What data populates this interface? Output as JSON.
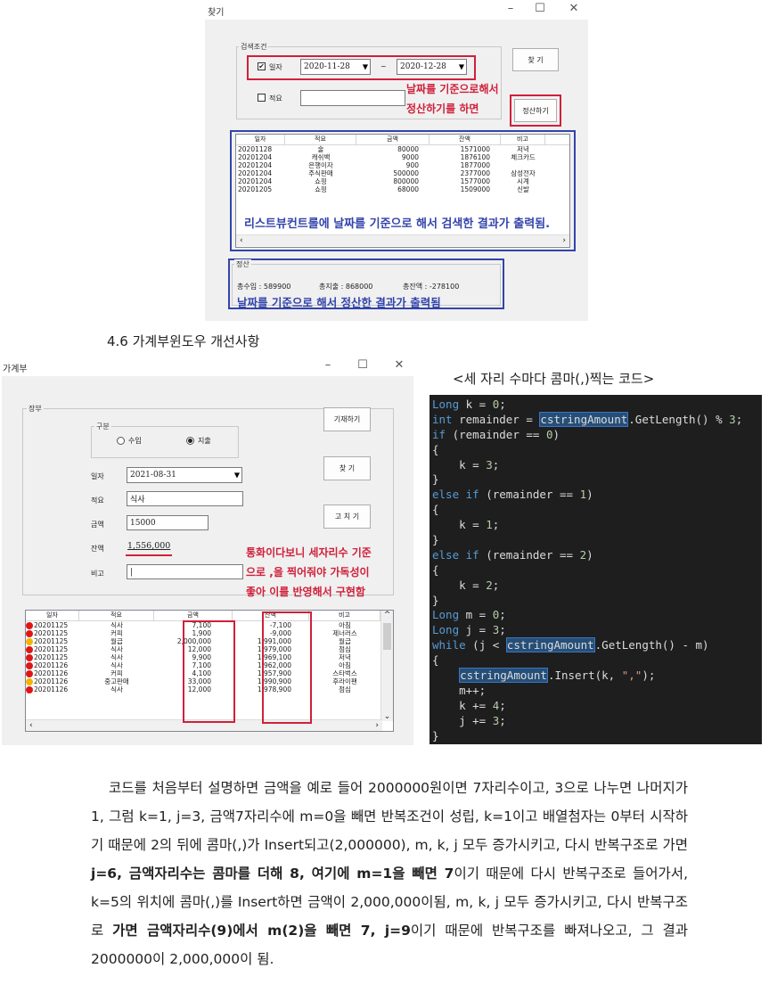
{
  "search_window": {
    "title": "찾기",
    "controls": [
      "–",
      "☐",
      "✕"
    ],
    "group_search": "검색조건",
    "date_check": "✔",
    "date_label": "일자",
    "date_from": "2020-11-28",
    "tilde": "~",
    "date_to": "2020-12-28",
    "memo_label": "적요",
    "find_button": "찾 기",
    "settle_button": "정산하기",
    "annotation_red": [
      "날짜를 기준으로해서",
      "정산하기를 하면"
    ],
    "list_headers": [
      "일자",
      "적요",
      "금액",
      "잔액",
      "비고"
    ],
    "list_rows": [
      [
        "20201128",
        "술",
        "80000",
        "1571000",
        "저녁"
      ],
      [
        "20201204",
        "캐쉬백",
        "9000",
        "1876100",
        "체크카드"
      ],
      [
        "20201204",
        "은행이자",
        "900",
        "1877000",
        ""
      ],
      [
        "20201204",
        "주식판매",
        "500000",
        "2377000",
        "삼성전자"
      ],
      [
        "20201204",
        "쇼핑",
        "800000",
        "1577000",
        "시계"
      ],
      [
        "20201205",
        "쇼핑",
        "68000",
        "1509000",
        "신발"
      ]
    ],
    "annotation_list": "리스트뷰컨트롤에 날짜를 기준으로 해서 검색한 결과가 출력됨.",
    "group_settle": "정산",
    "income": "총수입 :  589900",
    "expense": "총지출 :  868000",
    "balance": "총잔액 :  -278100",
    "annotation_settle": "날짜를 기준으로 해서 정산한 결과가 출력됨"
  },
  "caption_46": "4.6 가계부윈도우 개선사항",
  "ledger_window": {
    "title": "가계부",
    "controls": [
      "–",
      "☐",
      "✕"
    ],
    "group_ledger": "장부",
    "group_kind": "구분",
    "radio_income": "수입",
    "radio_expense": "지출",
    "date_label": "일자",
    "date_value": "2021-08-31",
    "memo_label": "적요",
    "memo_value": "식사",
    "amount_label": "금액",
    "amount_value": "15000",
    "balance_label": "잔액",
    "balance_value": "1,556,000",
    "note_label": "비고",
    "btn_record": "기재하기",
    "btn_find": "찾 기",
    "btn_edit": "고 치 기",
    "annotation": [
      "통화이다보니 세자리수 기준",
      "으로 ,을 찍어줘야 가독성이",
      "좋아 이를 반영해서 구현함"
    ],
    "list_headers": [
      "일자",
      "적요",
      "금액",
      "잔액",
      "비고"
    ],
    "list_rows": [
      {
        "icon": "dot",
        "date": "20201125",
        "memo": "식사",
        "amount": "7,100",
        "balance": "-7,100",
        "note": "아침"
      },
      {
        "icon": "dot",
        "date": "20201125",
        "memo": "커피",
        "amount": "1,900",
        "balance": "-9,000",
        "note": "제너러스"
      },
      {
        "icon": "emoji",
        "date": "20201125",
        "memo": "월급",
        "amount": "2,000,000",
        "balance": "1,991,000",
        "note": "월급"
      },
      {
        "icon": "dot",
        "date": "20201125",
        "memo": "식사",
        "amount": "12,000",
        "balance": "1,979,000",
        "note": "점심"
      },
      {
        "icon": "dot",
        "date": "20201125",
        "memo": "식사",
        "amount": "9,900",
        "balance": "1,969,100",
        "note": "저녁"
      },
      {
        "icon": "dot",
        "date": "20201126",
        "memo": "식사",
        "amount": "7,100",
        "balance": "1,962,000",
        "note": "아침"
      },
      {
        "icon": "dot",
        "date": "20201126",
        "memo": "커피",
        "amount": "4,100",
        "balance": "1,957,900",
        "note": "스타벅스"
      },
      {
        "icon": "emoji",
        "date": "20201126",
        "memo": "중고판매",
        "amount": "33,000",
        "balance": "1,990,900",
        "note": "후라이팬"
      },
      {
        "icon": "dot",
        "date": "20201126",
        "memo": "식사",
        "amount": "12,000",
        "balance": "1,978,900",
        "note": "점심"
      }
    ]
  },
  "code_caption": "<세 자리 수마다 콤마(,)찍는 코드>",
  "code_lines": [
    "Long k = 0;",
    "int remainder = cstringAmount.GetLength() % 3;",
    "if (remainder == 0)",
    "{",
    "    k = 3;",
    "}",
    "else if (remainder == 1)",
    "{",
    "    k = 1;",
    "}",
    "else if (remainder == 2)",
    "{",
    "    k = 2;",
    "}",
    "Long m = 0;",
    "Long j = 3;",
    "while (j < cstringAmount.GetLength() - m)",
    "{",
    "    cstringAmount.Insert(k, \",\");",
    "    m++;",
    "    k += 4;",
    "    j += 3;",
    "}"
  ],
  "paragraph": {
    "p1": "코드를 처음부터 설명하면 금액을 예로 들어 2000000원이면 7자리수이고, 3으로 나누면 나머지가 1, 그럼 k=1, j=3, 금액7자리수에 m=0을 빼면 반복조건이 성립, k=1이고 배열첨자는 0부터 시작하기 때문에 2의 뒤에 콤마(,)가 Insert되고(2,000000), m, k, j 모두 증가시키고, 다시 반복구조로 가면 ",
    "b1": "j=6, 금액자리수는 콤마를 더해 8, 여기에 m=1을 빼면 7",
    "p2": "이기 때문에 다시 반복구조로 들어가서, k=5의 위치에 콤마(,)를 Insert하면 금액이 2,000,000이됨, m, k, j 모두 증가시키고, 다시 반복구조로 ",
    "b2": "가면 금액자리수(9)에서 m(2)을 빼면 7, j=9",
    "p3": "이기 때문에 반복구조를 빠져나오고, 그 결과 2000000이 2,000,000이 됨."
  }
}
